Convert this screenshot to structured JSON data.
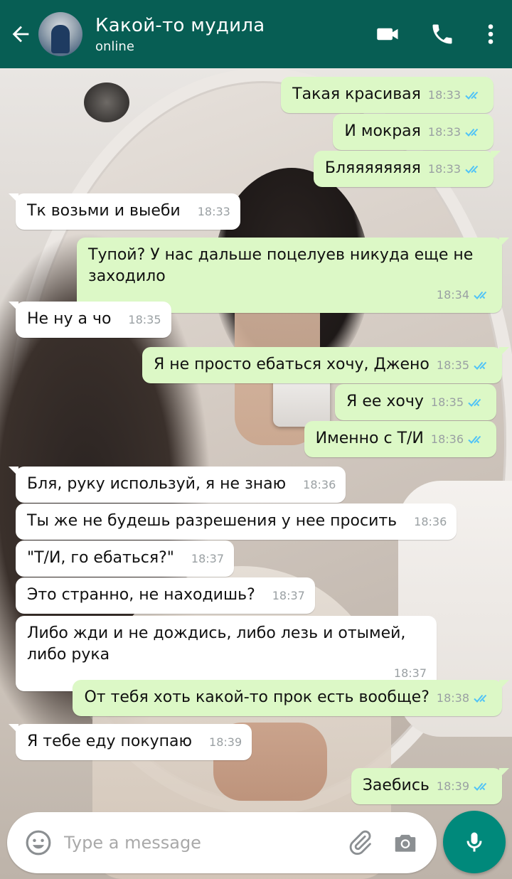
{
  "colors": {
    "header": "#075e54",
    "outgoing_bubble": "#dcf8c6",
    "incoming_bubble": "#ffffff",
    "read_ticks": "#4fc3f7",
    "mic_button": "#00897b"
  },
  "header": {
    "back_icon": "arrow-left-icon",
    "contact_name": "Какой-то мудила",
    "status": "online",
    "video_icon": "video-camera-icon",
    "call_icon": "phone-icon",
    "menu_icon": "more-vertical-icon"
  },
  "messages": [
    {
      "dir": "out",
      "text": "Такая красивая",
      "time": "18:33",
      "read": true
    },
    {
      "dir": "out",
      "text": "И мокрая",
      "time": "18:33",
      "read": true
    },
    {
      "dir": "out",
      "text": "Бляяяяяяяя",
      "time": "18:33",
      "read": true
    },
    {
      "dir": "in",
      "text": "Тк возьми и выеби",
      "time": "18:33"
    },
    {
      "dir": "out",
      "text": "Тупой? У нас дальше поцелуев никуда еще не заходило",
      "time": "18:34",
      "read": true
    },
    {
      "dir": "in",
      "text": "Не ну а чо",
      "time": "18:35"
    },
    {
      "dir": "out",
      "text": "Я не просто ебаться хочу, Джено",
      "time": "18:35",
      "read": true
    },
    {
      "dir": "out",
      "text": "Я ее хочу",
      "time": "18:35",
      "read": true
    },
    {
      "dir": "out",
      "text": "Именно с Т/И",
      "time": "18:36",
      "read": true
    },
    {
      "dir": "in",
      "text": "Бля, руку используй, я не знаю",
      "time": "18:36"
    },
    {
      "dir": "in",
      "text": "Ты же не будешь разрешения у нее просить",
      "time": "18:36"
    },
    {
      "dir": "in",
      "text": "\"Т/И, го ебаться?\"",
      "time": "18:37"
    },
    {
      "dir": "in",
      "text": "Это странно, не находишь?",
      "time": "18:37"
    },
    {
      "dir": "in",
      "text": "Либо жди и не дождись, либо лезь и отымей, либо рука",
      "time": "18:37"
    },
    {
      "dir": "out",
      "text": "От тебя хоть какой-то прок есть вообще?",
      "time": "18:38",
      "read": true
    },
    {
      "dir": "in",
      "text": "Я тебе еду покупаю",
      "time": "18:39"
    },
    {
      "dir": "out",
      "text": "Заебись",
      "time": "18:39",
      "read": true
    }
  ],
  "input": {
    "placeholder": "Type a message",
    "emoji_icon": "emoji-icon",
    "attach_icon": "paperclip-icon",
    "camera_icon": "camera-icon",
    "mic_icon": "microphone-icon"
  }
}
